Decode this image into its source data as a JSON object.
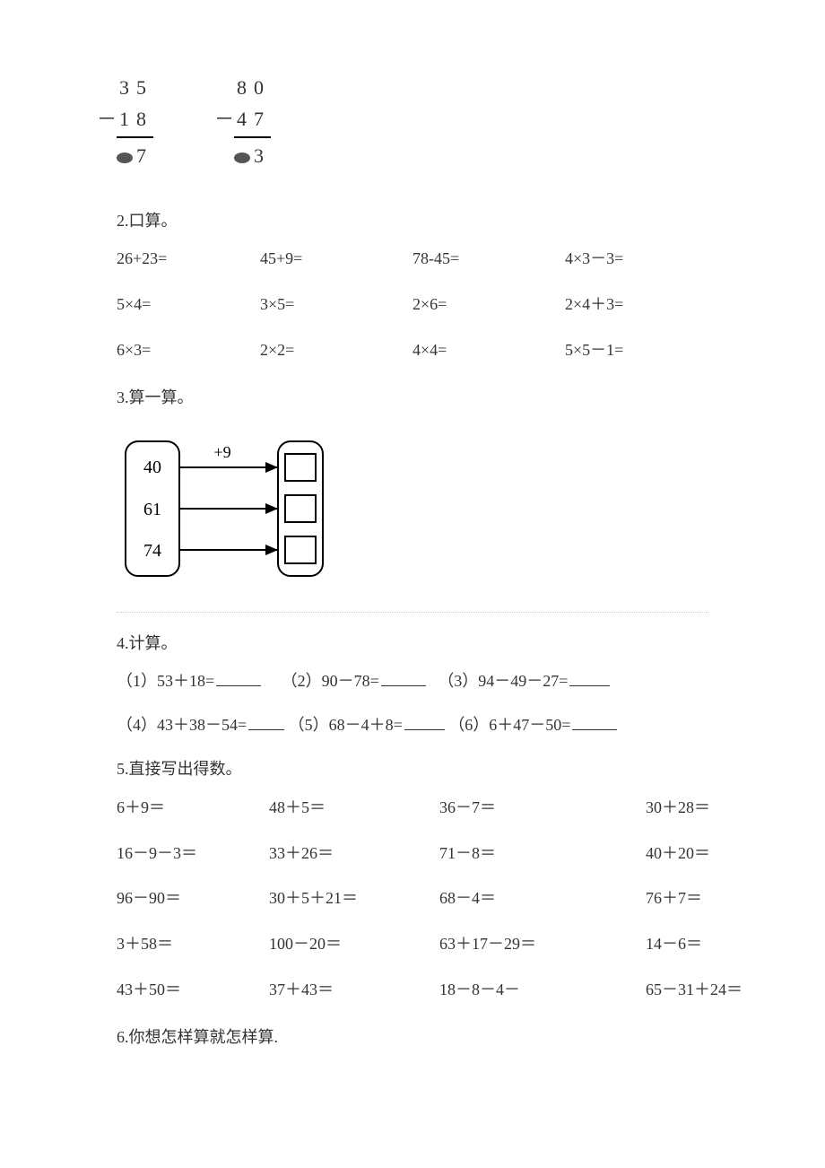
{
  "vertical": {
    "p1": {
      "top": "35",
      "bottom": "18",
      "resultDigit": "7"
    },
    "p2": {
      "top": "80",
      "bottom": "47",
      "resultDigit": "3"
    }
  },
  "sections": {
    "s2_title": "2.口算。",
    "s3_title": "3.算一算。",
    "s4_title": "4.计算。",
    "s5_title": "5.直接写出得数。",
    "s6_title": "6.你想怎样算就怎样算."
  },
  "q2_grid": [
    [
      "26+23=",
      "45+9=",
      "78-45=",
      "4×3－3="
    ],
    [
      "5×4=",
      "3×5=",
      "2×6=",
      "2×4＋3="
    ],
    [
      "6×3=",
      "2×2=",
      "4×4=",
      "5×5－1="
    ]
  ],
  "q3_diagram": {
    "operation": "+9",
    "inputs": [
      "40",
      "61",
      "74"
    ]
  },
  "q4": {
    "row1": [
      {
        "label": "（1）53＋18="
      },
      {
        "label": "（2）90－78="
      },
      {
        "label": "（3）94－49－27="
      }
    ],
    "row2": [
      {
        "label": "（4）43＋38－54="
      },
      {
        "label": "（5）68－4＋8="
      },
      {
        "label": "（6）6＋47－50="
      }
    ]
  },
  "q5_grid": [
    [
      "6＋9＝",
      "48＋5＝",
      "36－7＝",
      "30＋28＝"
    ],
    [
      "16－9－3＝",
      "33＋26＝",
      "71－8＝",
      "40＋20＝"
    ],
    [
      "96－90＝",
      "30＋5＋21＝",
      "68－4＝",
      "76＋7＝"
    ],
    [
      "3＋58＝",
      "100－20＝",
      "63＋17－29＝",
      "14－6＝"
    ],
    [
      "43＋50＝",
      "37＋43＝",
      "18－8－4－",
      "65－31＋24＝"
    ]
  ]
}
